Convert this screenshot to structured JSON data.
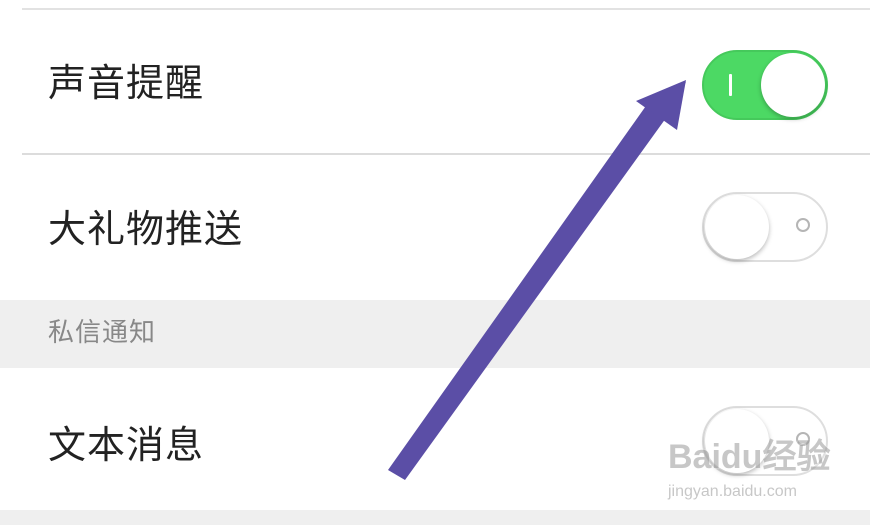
{
  "settings": {
    "rows": [
      {
        "label": "声音提醒",
        "toggle_on": true
      },
      {
        "label": "大礼物推送",
        "toggle_on": false
      },
      {
        "label": "文本消息",
        "toggle_on": false
      }
    ],
    "section_private_message": "私信通知"
  },
  "colors": {
    "toggle_on": "#4cd964",
    "arrow": "#5b4ea6",
    "section_background": "#efefef"
  },
  "annotation": {
    "arrow_points_to": "sound-reminder-toggle"
  },
  "watermark": {
    "brand": "Baidu经验",
    "url": "jingyan.baidu.com"
  }
}
